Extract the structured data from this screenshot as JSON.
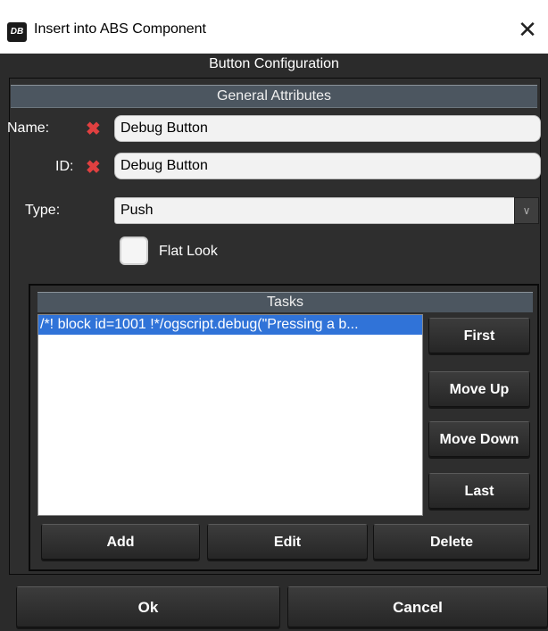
{
  "window": {
    "title": "Insert into ABS Component",
    "close_label": "✕",
    "app_icon_text": "DB"
  },
  "dialog": {
    "subtitle": "Button Configuration"
  },
  "general": {
    "header": "General Attributes",
    "name_label": "Name:",
    "name_value": "Debug Button",
    "id_label": "ID:",
    "id_value": "Debug Button",
    "type_label": "Type:",
    "type_value": "Push",
    "flat_look_label": "Flat Look",
    "flat_look_checked": false,
    "required_marker": "✖"
  },
  "tasks": {
    "header": "Tasks",
    "items": [
      "/*! block id=1001 !*/ogscript.debug(\"Pressing a b..."
    ],
    "side_buttons": [
      "First",
      "Move Up",
      "Move Down",
      "Last"
    ],
    "bottom_buttons": [
      "Add",
      "Edit",
      "Delete"
    ]
  },
  "footer": {
    "ok_label": "Ok",
    "cancel_label": "Cancel"
  }
}
